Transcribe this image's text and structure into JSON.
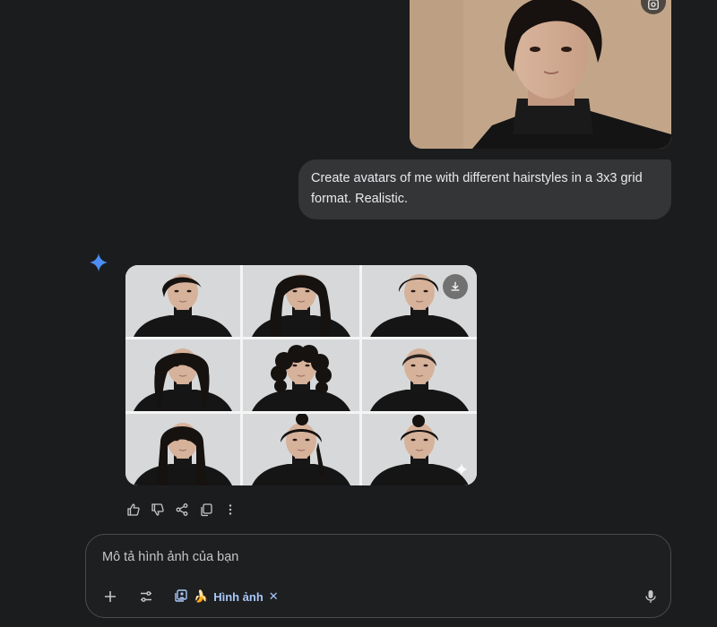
{
  "user_message": {
    "text": "Create avatars of me with different hairstyles in a 3x3 grid format. Realistic."
  },
  "generated_grid": {
    "rows": 3,
    "cols": 3,
    "cells": [
      {
        "hair": "short-side-part"
      },
      {
        "hair": "long-wavy"
      },
      {
        "hair": "short-textured"
      },
      {
        "hair": "shaggy-messy"
      },
      {
        "hair": "curly"
      },
      {
        "hair": "buzz-cut"
      },
      {
        "hair": "long-straight"
      },
      {
        "hair": "half-up-bun"
      },
      {
        "hair": "top-knot"
      }
    ]
  },
  "composer": {
    "placeholder": "Mô tả hình ảnh của bạn",
    "tool_chip_label": "Hình ảnh",
    "tool_chip_emoji": "🍌"
  },
  "colors": {
    "background": "#1b1c1e",
    "bubble": "#333537",
    "accent": "#a8c7fa",
    "sparkle": "#4c8df6"
  }
}
